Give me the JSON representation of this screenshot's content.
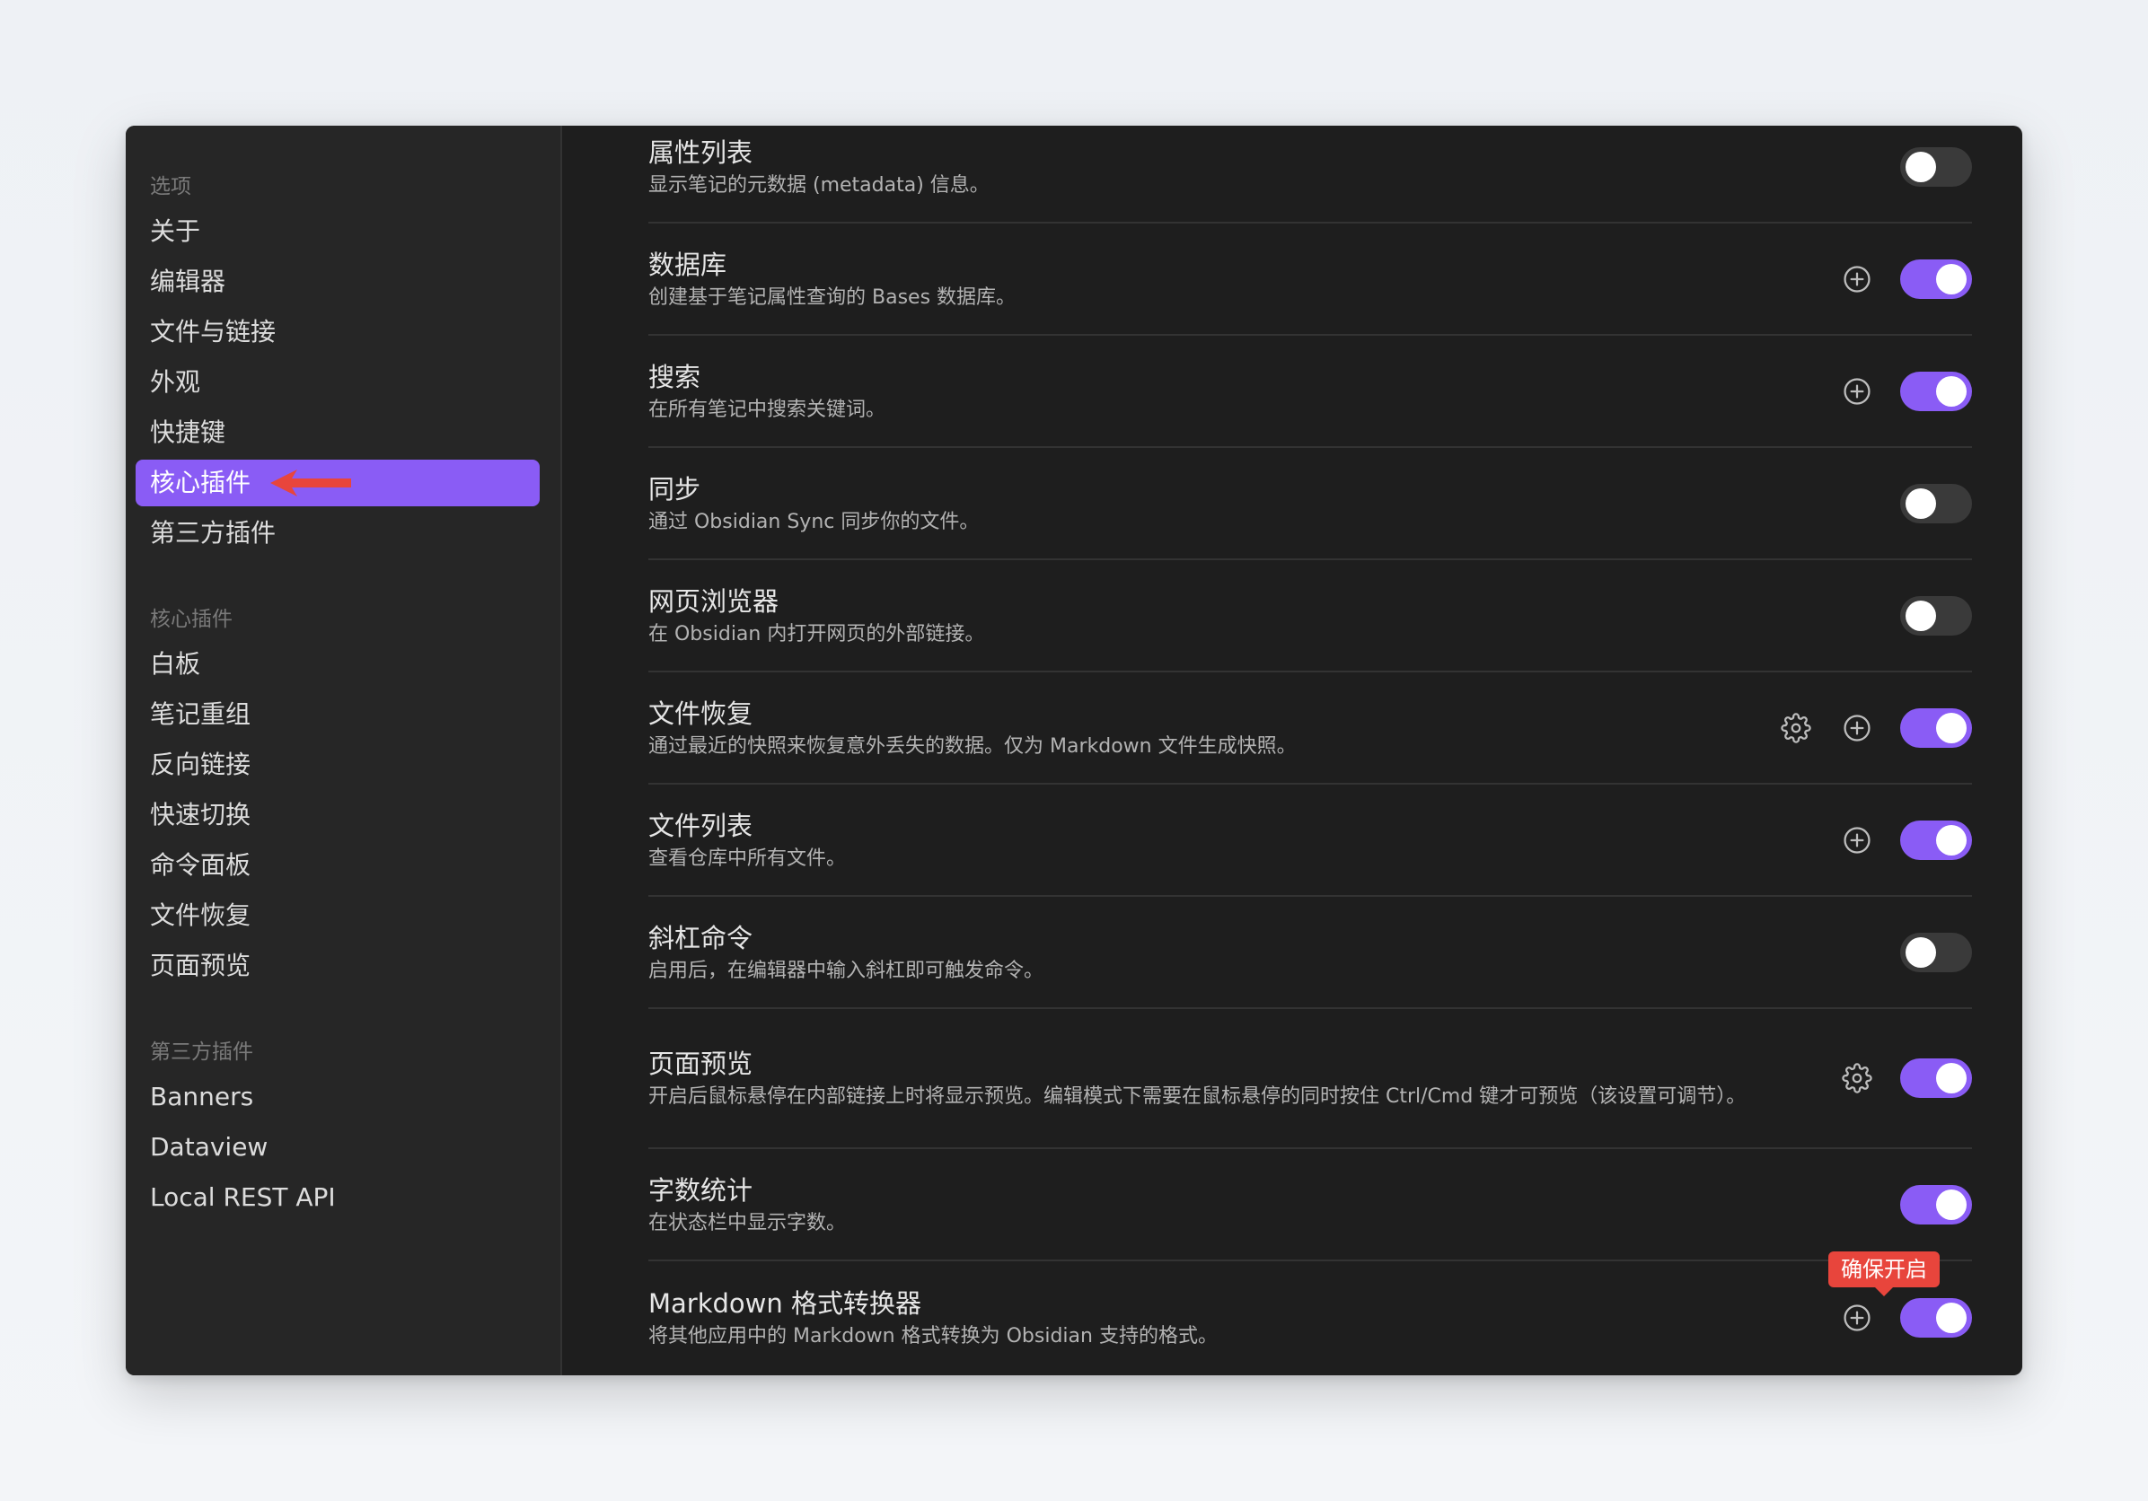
{
  "sidebar": {
    "groups": [
      {
        "title": "选项",
        "items": [
          "关于",
          "编辑器",
          "文件与链接",
          "外观",
          "快捷键",
          "核心插件",
          "第三方插件"
        ]
      },
      {
        "title": "核心插件",
        "items": [
          "白板",
          "笔记重组",
          "反向链接",
          "快速切换",
          "命令面板",
          "文件恢复",
          "页面预览"
        ]
      },
      {
        "title": "第三方插件",
        "items": [
          "Banners",
          "Dataview",
          "Local REST API"
        ]
      }
    ],
    "active_item": "核心插件"
  },
  "plugins": [
    {
      "title": "属性列表",
      "desc": "显示笔记的元数据 (metadata) 信息。",
      "enabled": false,
      "settings": false,
      "add": false
    },
    {
      "title": "数据库",
      "desc": "创建基于笔记属性查询的 Bases 数据库。",
      "enabled": true,
      "settings": false,
      "add": true
    },
    {
      "title": "搜索",
      "desc": "在所有笔记中搜索关键词。",
      "enabled": true,
      "settings": false,
      "add": true
    },
    {
      "title": "同步",
      "desc": "通过 Obsidian Sync 同步你的文件。",
      "enabled": false,
      "settings": false,
      "add": false
    },
    {
      "title": "网页浏览器",
      "desc": "在 Obsidian 内打开网页的外部链接。",
      "enabled": false,
      "settings": false,
      "add": false
    },
    {
      "title": "文件恢复",
      "desc": "通过最近的快照来恢复意外丢失的数据。仅为 Markdown 文件生成快照。",
      "enabled": true,
      "settings": true,
      "add": true
    },
    {
      "title": "文件列表",
      "desc": "查看仓库中所有文件。",
      "enabled": true,
      "settings": false,
      "add": true
    },
    {
      "title": "斜杠命令",
      "desc": "启用后，在编辑器中输入斜杠即可触发命令。",
      "enabled": false,
      "settings": false,
      "add": false
    },
    {
      "title": "页面预览",
      "desc": "开启后鼠标悬停在内部链接上时将显示预览。编辑模式下需要在鼠标悬停的同时按住 Ctrl/Cmd 键才可预览（该设置可调节）。",
      "enabled": true,
      "settings": true,
      "add": false
    },
    {
      "title": "字数统计",
      "desc": "在状态栏中显示字数。",
      "enabled": true,
      "settings": false,
      "add": false
    },
    {
      "title": "Markdown 格式转换器",
      "desc": "将其他应用中的 Markdown 格式转换为 Obsidian 支持的格式。",
      "enabled": true,
      "settings": false,
      "add": true,
      "callout": "确保开启"
    }
  ],
  "colors": {
    "accent": "#8a5cf5",
    "annotation": "#e8453c"
  },
  "icons": {
    "settings": "gear-icon",
    "add": "plus-circle-icon",
    "pointer": "red-arrow-icon"
  }
}
